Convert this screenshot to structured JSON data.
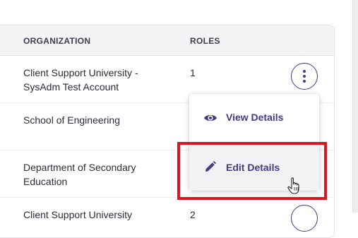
{
  "table": {
    "columns": {
      "organization": "ORGANIZATION",
      "roles": "ROLES"
    },
    "rows": [
      {
        "organization": "Client Support University - SysAdm Test Account",
        "roles": "1"
      },
      {
        "organization": "School of Engineering",
        "roles": ""
      },
      {
        "organization": "Department of Secondary Education",
        "roles": ""
      },
      {
        "organization": "Client Support University",
        "roles": "2"
      }
    ]
  },
  "row_menu": {
    "items": [
      {
        "label": "View Details",
        "icon": "eye-icon"
      },
      {
        "label": "Edit Details",
        "icon": "pencil-icon"
      }
    ]
  },
  "colors": {
    "accent": "#3f3a8a",
    "highlight": "#e0141f",
    "header_bg": "#f4f4f7"
  }
}
